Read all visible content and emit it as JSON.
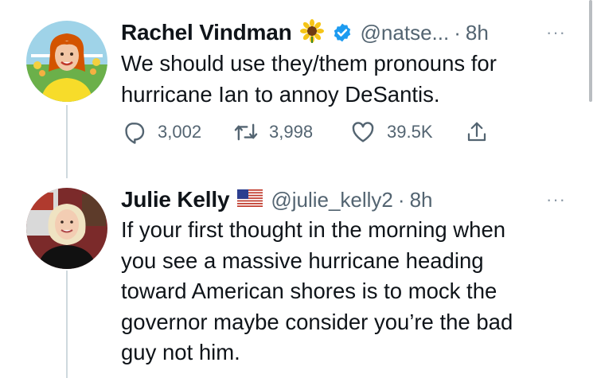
{
  "tweets": [
    {
      "display_name": "Rachel Vindman",
      "name_emoji": "sunflower",
      "verified": true,
      "handle": "@natse...",
      "separator": "·",
      "time": "8h",
      "text": "We should use they/them pronouns for\nhurricane Ian to annoy DeSantis.",
      "actions": {
        "replies": "3,002",
        "retweets": "3,998",
        "likes": "39.5K"
      }
    },
    {
      "display_name": "Julie Kelly",
      "name_emoji": "us-flag",
      "verified": false,
      "handle": "@julie_kelly2",
      "separator": "·",
      "time": "8h",
      "text": "If your first thought in the morning when\nyou see a massive hurricane heading\ntoward American shores is to mock the\ngovernor maybe consider you’re the bad\nguy not him."
    }
  ],
  "more_glyph": "···",
  "colors": {
    "text": "#0f1419",
    "secondary": "#536471",
    "verified": "#1d9bf0",
    "thread_line": "#cfd9de"
  }
}
